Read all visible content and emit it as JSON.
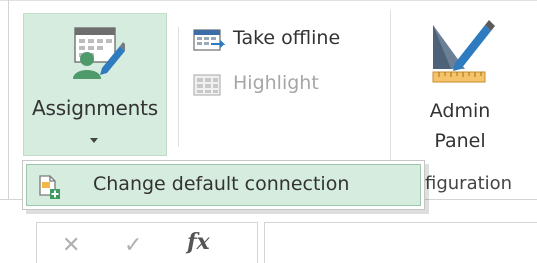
{
  "ribbon": {
    "assignments": {
      "label": "Assignments",
      "icon": "assignments-icon"
    },
    "take_offline": {
      "label": "Take offline",
      "icon": "take-offline-icon"
    },
    "highlight": {
      "label": "Highlight",
      "icon": "highlight-icon",
      "enabled": false
    },
    "admin_panel": {
      "label_line1": "Admin",
      "label_line2": "Panel",
      "icon": "admin-panel-icon"
    },
    "group_label": "figuration"
  },
  "dropdown_menu": {
    "items": [
      {
        "label": "Change default connection",
        "icon": "change-connection-icon",
        "highlighted": true
      }
    ]
  },
  "formula_bar": {
    "cancel": "✕",
    "enter": "✓",
    "function": "fx"
  },
  "colors": {
    "accent_green_bg": "#d5ecdf",
    "accent_green_border": "#9ec6ad",
    "text": "#333333",
    "disabled_text": "#a6a6a6"
  }
}
